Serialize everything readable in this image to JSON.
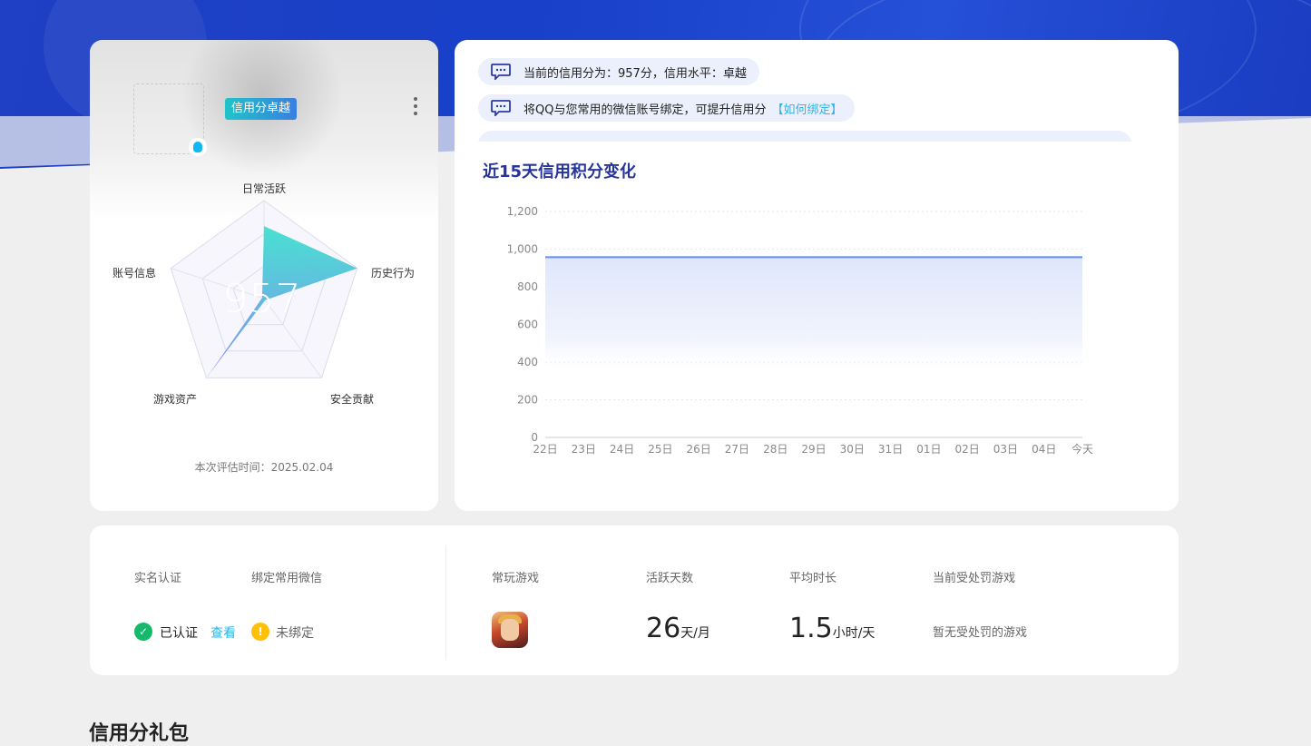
{
  "profile": {
    "level_badge": "信用分卓越",
    "score": "957",
    "eval_time": "本次评估时间：2025.02.04",
    "radar": {
      "axes": [
        "日常活跃",
        "历史行为",
        "安全贡献",
        "游戏资产",
        "账号信息"
      ],
      "values": [
        0.74,
        1.0,
        0.02,
        0.93,
        0.02
      ]
    }
  },
  "notices": [
    {
      "text": "当前的信用分为：957分，信用水平：卓越",
      "link": ""
    },
    {
      "text": "将QQ与您常用的微信账号绑定，可提升信用分",
      "link": "【如何绑定】"
    }
  ],
  "chart_title": "近15天信用积分变化",
  "chart_data": {
    "type": "area",
    "x": [
      "22日",
      "23日",
      "24日",
      "25日",
      "26日",
      "27日",
      "28日",
      "29日",
      "30日",
      "31日",
      "01日",
      "02日",
      "03日",
      "04日",
      "今天"
    ],
    "series": [
      {
        "values": [
          957,
          957,
          957,
          957,
          957,
          957,
          957,
          957,
          957,
          957,
          957,
          957,
          957,
          957,
          957
        ]
      }
    ],
    "yticks": [
      "0",
      "200",
      "400",
      "600",
      "800",
      "1,000",
      "1,200"
    ],
    "ylim": [
      0,
      1200
    ],
    "grid": true,
    "line_color": "#5b8ff9"
  },
  "stats": {
    "realname_label": "实名认证",
    "wechat_label": "绑定常用微信",
    "realname_value": "已认证",
    "realname_link": "查看",
    "wechat_value": "未绑定",
    "game_label": "常玩游戏",
    "active_label": "活跃天数",
    "active_value": "26",
    "active_unit": "天/月",
    "avg_label": "平均时长",
    "avg_value": "1.5",
    "avg_unit": "小时/天",
    "penalty_label": "当前受处罚游戏",
    "penalty_value": "暂无受处罚的游戏"
  },
  "section_heading": "信用分礼包",
  "colors": {
    "accent": "#27349a",
    "link": "#2fb3e6",
    "success": "#14b96a",
    "warning": "#ffc107"
  }
}
